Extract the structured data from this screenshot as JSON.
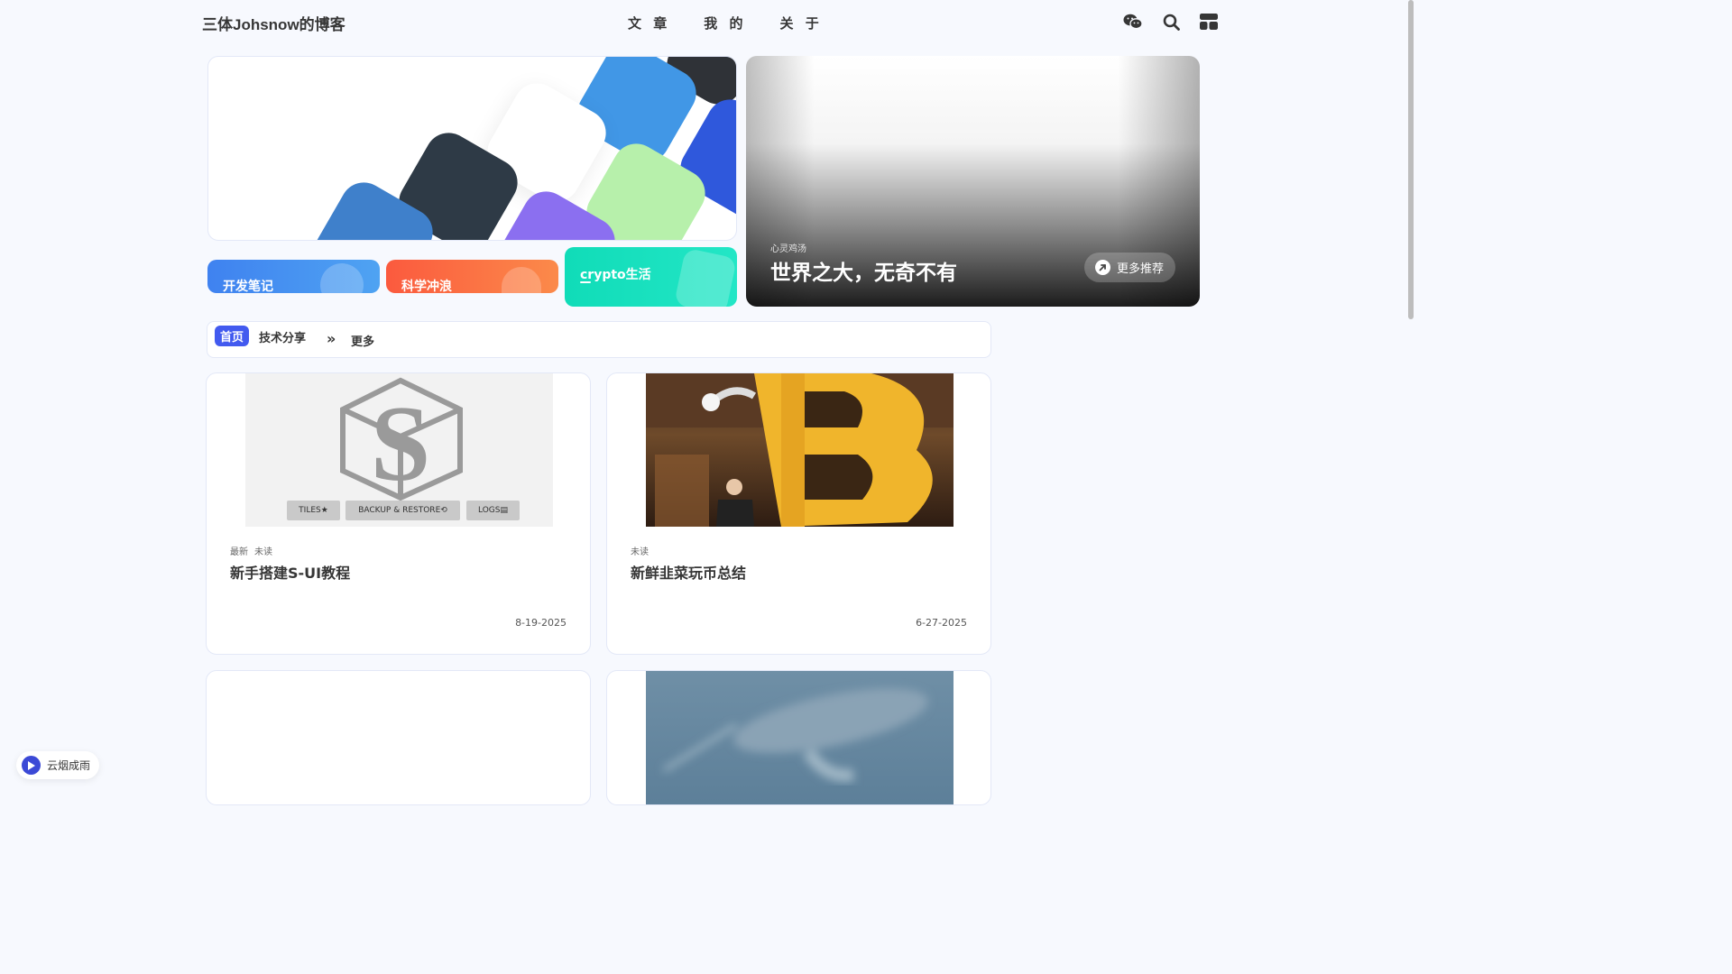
{
  "header": {
    "site_name": "三体Johsnow的博客",
    "menu": [
      "文 章",
      "我 的",
      "关 于"
    ]
  },
  "categories": [
    {
      "label": "开发笔记",
      "color": "#3f8cf0"
    },
    {
      "label": "科学冲浪",
      "color": "#fb6a3f"
    },
    {
      "label": "crypto生活",
      "color": "#18e1bd"
    }
  ],
  "recommend": {
    "tag": "心灵鸡汤",
    "title": "世界之大，无奇不有",
    "button": "更多推荐"
  },
  "category_bar": {
    "home": "首页",
    "tech": "技术分享",
    "arrow": "»",
    "more": "更多"
  },
  "posts": [
    {
      "tags": [
        "最新",
        "未读"
      ],
      "title": "新手搭建S-UI教程",
      "date": "8-19-2025",
      "cover_buttons": [
        "TILES★",
        "BACKUP & RESTORE⟲",
        "LOGS▤"
      ]
    },
    {
      "tags": [
        "未读"
      ],
      "title": "新鲜韭菜玩币总结",
      "date": "6-27-2025"
    }
  ],
  "music": {
    "label": "云烟成雨"
  },
  "colors": {
    "accent": "#425aef",
    "background": "#f7f9fe"
  }
}
